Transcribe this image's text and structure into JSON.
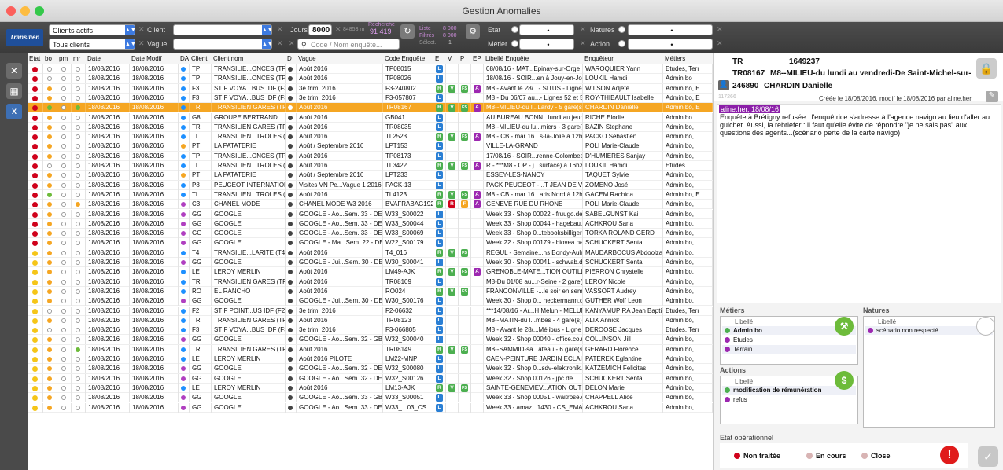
{
  "window": {
    "title": "Gestion Anomalies"
  },
  "toolbar": {
    "logo": "Transilien",
    "client_filter1": "Clients actifs",
    "client_filter2": "Tous clients",
    "client_label": "Client",
    "vague_label": "Vague",
    "jours_label": "Jours",
    "jours_value": "8000",
    "jours_small": "84853 m",
    "recherche_label": "Recherche",
    "recherche_value": "91 419",
    "liste_label": "Liste",
    "liste_value": "8 000",
    "filtres_label": "Filtrés",
    "filtres_value": "8 000",
    "selec_label": "Sélect.",
    "selec_value": "1",
    "search_placeholder": "Code / Nom enquête...",
    "etat_label": "Etat",
    "metier_label": "Métier",
    "natures_label": "Natures",
    "action_label": "Action",
    "dot": "•"
  },
  "columns": [
    "Etat",
    "bo",
    "pm",
    "mr",
    "Date",
    "Date Modif",
    "DA",
    "Client",
    "Client nom",
    "D",
    "Vague",
    "Code Enquête",
    "E",
    "V",
    "P",
    "EP",
    "Libellé Enquête",
    "Enquêteur",
    "Métiers"
  ],
  "rows": [
    {
      "etat": "#d0021b",
      "bo": "o",
      "pm": "o",
      "mr": "o",
      "date": "18/08/2016",
      "modif": "18/08/2016",
      "da": "#1e90ff",
      "cl": "TP",
      "nom": "TRANSILIE...ONCES (TP)",
      "vague": "Août 2016",
      "code": "TP08015",
      "b": [
        "L"
      ],
      "lib": "08/08/16 - MAT...Epinay-sur-Orge",
      "enq": "WAROQUIER Yann",
      "met": "Etudes, Terr"
    },
    {
      "etat": "#d0021b",
      "bo": "o",
      "pm": "o",
      "mr": "o",
      "date": "18/08/2016",
      "modif": "18/08/2016",
      "da": "#1e90ff",
      "cl": "TP",
      "nom": "TRANSILIE...ONCES (TP)",
      "vague": "Août 2016",
      "code": "TP08026",
      "b": [
        "L"
      ],
      "lib": "18/08/16 - SOIR...en à Jouy-en-Josas",
      "enq": "LOUKIL Hamdi",
      "met": "Admin bo"
    },
    {
      "etat": "#d0021b",
      "bo": "y",
      "pm": "o",
      "mr": "o",
      "date": "18/08/2016",
      "modif": "18/08/2016",
      "da": "#1e90ff",
      "cl": "F3",
      "nom": "STIF VOYA...BUS IDF (F3)",
      "vague": "3e trim. 2016",
      "code": "F3-240802",
      "b": [
        "R",
        "V",
        "FS",
        "A"
      ],
      "lib": "M8 - Avant le 28/...- SITUS - Ligne 1",
      "enq": "WILSON Adjété",
      "met": "Admin bo, E"
    },
    {
      "etat": "#d0021b",
      "bo": "y",
      "pm": "o",
      "mr": "o",
      "date": "18/08/2016",
      "modif": "18/08/2016",
      "da": "#1e90ff",
      "cl": "F3",
      "nom": "STIF VOYA...BUS IDF (F3)",
      "vague": "3e trim. 2016",
      "code": "F3-057807",
      "b": [
        "L"
      ],
      "lib": "M8 - Du 06/07 au...- Lignes 52 et 50",
      "enq": "ROY-THIBAULT Isabelle",
      "met": "Admin bo, E"
    },
    {
      "etat": "#d0021b",
      "bo": "g",
      "pm": "o",
      "mr": "g",
      "date": "18/08/2016",
      "modif": "18/08/2016",
      "da": "#1e90ff",
      "cl": "TR",
      "nom": "TRANSILIEN GARES (TR)",
      "vague": "Août 2016",
      "code": "TR08167",
      "b": [
        "R",
        "V",
        "FS",
        "A"
      ],
      "lib": "M8--MILIEU-du l...Lardy - 5 gare(s)",
      "enq": "CHARDIN Danielle",
      "met": "Admin bo, E",
      "sel": true
    },
    {
      "etat": "#d0021b",
      "bo": "y",
      "pm": "o",
      "mr": "o",
      "date": "18/08/2016",
      "modif": "18/08/2016",
      "da": "#1e90ff",
      "cl": "G8",
      "nom": "GROUPE BERTRAND",
      "vague": "Août 2016",
      "code": "GB041",
      "b": [
        "L"
      ],
      "lib": "AU BUREAU BONN...lundi au jeudi soir",
      "enq": "RICHE Elodie",
      "met": "Admin bo"
    },
    {
      "etat": "#d0021b",
      "bo": "y",
      "pm": "o",
      "mr": "o",
      "date": "18/08/2016",
      "modif": "18/08/2016",
      "da": "#1e90ff",
      "cl": "TR",
      "nom": "TRANSILIEN GARES (TR)",
      "vague": "Août 2016",
      "code": "TR08035",
      "b": [
        "L"
      ],
      "lib": "M8--MILIEU-du lu...miers - 3 gare(s)",
      "enq": "BAZIN Stephane",
      "met": "Admin bo,"
    },
    {
      "etat": "#d0021b",
      "bo": "y",
      "pm": "o",
      "mr": "o",
      "date": "18/08/2016",
      "modif": "18/08/2016",
      "da": "#1e90ff",
      "cl": "TL",
      "nom": "TRANSILIEN...TROLES (TL)",
      "vague": "Août 2016",
      "code": "TL2523",
      "b": [
        "R",
        "V",
        "FS",
        "A"
      ],
      "lib": "M8 - CB - mar 16...s-la-Jolie à 12h50",
      "enq": "PACKO Sébastien",
      "met": "Admin bo,"
    },
    {
      "etat": "#d0021b",
      "bo": "y",
      "pm": "o",
      "mr": "o",
      "date": "18/08/2016",
      "modif": "18/08/2016",
      "da": "#f5a623",
      "cl": "PT",
      "nom": "LA PATATERIE",
      "vague": "Août / Septembre 2016",
      "code": "LPT153",
      "b": [
        "L"
      ],
      "lib": "VILLE-LA-GRAND",
      "enq": "POLI Marie-Claude",
      "met": "Admin bo,"
    },
    {
      "etat": "#d0021b",
      "bo": "y",
      "pm": "o",
      "mr": "o",
      "date": "18/08/2016",
      "modif": "18/08/2016",
      "da": "#1e90ff",
      "cl": "TP",
      "nom": "TRANSILIE...ONCES (TP)",
      "vague": "Août 2016",
      "code": "TP08173",
      "b": [
        "L"
      ],
      "lib": "17/08/16 - SOIR...renne-Colombes",
      "enq": "D'HUMIERES Sanjay",
      "met": "Admin bo,"
    },
    {
      "etat": "#d0021b",
      "bo": "o",
      "pm": "o",
      "mr": "o",
      "date": "18/08/2016",
      "modif": "18/08/2016",
      "da": "#1e90ff",
      "cl": "TL",
      "nom": "TRANSILIEN...TROLES (TL)",
      "vague": "Août 2016",
      "code": "TL3422",
      "b": [
        "R",
        "V",
        "FS",
        "A"
      ],
      "lib": "R - ***M8 - OP - j...surface) à 16h30",
      "enq": "LOUKIL Hamdi",
      "met": "Etudes"
    },
    {
      "etat": "#d0021b",
      "bo": "y",
      "pm": "o",
      "mr": "o",
      "date": "18/08/2016",
      "modif": "18/08/2016",
      "da": "#f5a623",
      "cl": "PT",
      "nom": "LA PATATERIE",
      "vague": "Août / Septembre 2016",
      "code": "LPT233",
      "b": [
        "L"
      ],
      "lib": "ESSEY-LES-NANCY",
      "enq": "TAQUET Sylvie",
      "met": "Admin bo,"
    },
    {
      "etat": "#d0021b",
      "bo": "y",
      "pm": "o",
      "mr": "o",
      "date": "18/08/2016",
      "modif": "18/08/2016",
      "da": "#1e90ff",
      "cl": "P8",
      "nom": "PEUGEOT INTERNATIONAL",
      "vague": "Visites VN Pe...Vague 1 2016",
      "code": "PACK-13",
      "b": [
        "L"
      ],
      "lib": "PACK PEUGEOT -...T JEAN DE VEDAS",
      "enq": "ZOMENO José",
      "met": "Admin bo,"
    },
    {
      "etat": "#d0021b",
      "bo": "g",
      "pm": "o",
      "mr": "o",
      "date": "18/08/2016",
      "modif": "18/08/2016",
      "da": "#1e90ff",
      "cl": "TL",
      "nom": "TRANSILIEN...TROLES (TL)",
      "vague": "Août 2016",
      "code": "TL4123",
      "b": [
        "R",
        "V",
        "FS",
        "A"
      ],
      "lib": "M8 - CB - mar 16...aris Nord à 12h10",
      "enq": "GACEM Rachida",
      "met": "Admin bo, E"
    },
    {
      "etat": "#d0021b",
      "bo": "y",
      "pm": "o",
      "mr": "y",
      "date": "18/08/2016",
      "modif": "18/08/2016",
      "da": "#b03fc0",
      "cl": "C3",
      "nom": "CHANEL MODE",
      "vague": "CHANEL MODE W3 2016",
      "code": "BVAFRABAG192",
      "b": [
        "R",
        "Rr",
        "F",
        "A"
      ],
      "lib": "GENEVE RUE DU RHONE",
      "enq": "POLI Marie-Claude",
      "met": "Admin bo,"
    },
    {
      "etat": "#d0021b",
      "bo": "y",
      "pm": "o",
      "mr": "o",
      "date": "18/08/2016",
      "modif": "18/08/2016",
      "da": "#b03fc0",
      "cl": "GG",
      "nom": "GOOGLE",
      "vague": "GOOGLE - Ao...Sem. 33 - DE",
      "code": "W33_S00022",
      "b": [
        "L"
      ],
      "lib": "Week 33 - Shop 00022 - fruugo.de",
      "enq": "SABELGUNST Kai",
      "met": "Admin bo,"
    },
    {
      "etat": "#d0021b",
      "bo": "y",
      "pm": "o",
      "mr": "o",
      "date": "18/08/2016",
      "modif": "18/08/2016",
      "da": "#b03fc0",
      "cl": "GG",
      "nom": "GOOGLE",
      "vague": "GOOGLE - Ao...Sem. 33 - DE",
      "code": "W33_S00044",
      "b": [
        "L"
      ],
      "lib": "Week 33 - Shop 00044 - hagebau.de",
      "enq": "ACHKROU Sana",
      "met": "Admin bo,"
    },
    {
      "etat": "#d0021b",
      "bo": "y",
      "pm": "o",
      "mr": "o",
      "date": "18/08/2016",
      "modif": "18/08/2016",
      "da": "#b03fc0",
      "cl": "GG",
      "nom": "GOOGLE",
      "vague": "GOOGLE - Ao...Sem. 33 - DE",
      "code": "W33_S00069",
      "b": [
        "L"
      ],
      "lib": "Week 33 - Shop 0...tebooksbilliger.de",
      "enq": "TORKA ROLAND GERD",
      "met": "Admin bo,"
    },
    {
      "etat": "#d0021b",
      "bo": "y",
      "pm": "o",
      "mr": "o",
      "date": "18/08/2016",
      "modif": "18/08/2016",
      "da": "#b03fc0",
      "cl": "GG",
      "nom": "GOOGLE",
      "vague": "GOOGLE - Ma...Sem. 22 - DE",
      "code": "W22_S00179",
      "b": [
        "L"
      ],
      "lib": "Week 22 - Shop 00179 - biovea.net",
      "enq": "SCHUCKERT Senta",
      "met": "Admin bo,"
    },
    {
      "etat": "#f5c518",
      "bo": "y",
      "pm": "o",
      "mr": "o",
      "date": "18/08/2016",
      "modif": "18/08/2016",
      "da": "#1e90ff",
      "cl": "T4",
      "nom": "TRANSILIE...LARITE (T4)",
      "vague": "Août 2016",
      "code": "T4_016",
      "b": [
        "R",
        "V",
        "FS"
      ],
      "lib": "REGUL - Semaine...ns Bondy-Aulnay",
      "enq": "MAUDARBOCUS Abdoolzahid",
      "met": "Admin bo,"
    },
    {
      "etat": "#f5c518",
      "bo": "y",
      "pm": "o",
      "mr": "o",
      "date": "18/08/2016",
      "modif": "18/08/2016",
      "da": "#b03fc0",
      "cl": "GG",
      "nom": "GOOGLE",
      "vague": "GOOGLE - Jui...Sem. 30 - DE",
      "code": "W30_S00041",
      "b": [
        "L"
      ],
      "lib": "Week 30 - Shop 00041 - schwab.de",
      "enq": "SCHUCKERT Senta",
      "met": "Admin bo,"
    },
    {
      "etat": "#f5c518",
      "bo": "y",
      "pm": "o",
      "mr": "o",
      "date": "18/08/2016",
      "modif": "18/08/2016",
      "da": "#1e90ff",
      "cl": "LE",
      "nom": "LEROY MERLIN",
      "vague": "Août 2016",
      "code": "LM49-AJK",
      "b": [
        "R",
        "V",
        "FS",
        "A"
      ],
      "lib": "GRENOBLE-MATE...TION OUTILLAGE",
      "enq": "PIERRON Chrystelle",
      "met": "Admin bo,"
    },
    {
      "etat": "#f5c518",
      "bo": "y",
      "pm": "o",
      "mr": "o",
      "date": "18/08/2016",
      "modif": "18/08/2016",
      "da": "#1e90ff",
      "cl": "TR",
      "nom": "TRANSILIEN GARES (TR)",
      "vague": "Août 2016",
      "code": "TR08109",
      "b": [
        "L"
      ],
      "lib": "M8-Du 01/08 au...r-Seine - 2 gare(s)",
      "enq": "LEROY Nicole",
      "met": "Admin bo,"
    },
    {
      "etat": "#f5c518",
      "bo": "y",
      "pm": "o",
      "mr": "o",
      "date": "18/08/2016",
      "modif": "18/08/2016",
      "da": "#1e90ff",
      "cl": "RO",
      "nom": "EL RANCHO",
      "vague": "Août 2016",
      "code": "RO024",
      "b": [
        "R",
        "V",
        "FS"
      ],
      "lib": "FRANCONVILLE -...le soir en semaine",
      "enq": "VASSORT Audrey",
      "met": "Admin bo,"
    },
    {
      "etat": "#f5c518",
      "bo": "y",
      "pm": "o",
      "mr": "o",
      "date": "18/08/2016",
      "modif": "18/08/2016",
      "da": "#b03fc0",
      "cl": "GG",
      "nom": "GOOGLE",
      "vague": "GOOGLE - Jui...Sem. 30 - DE",
      "code": "W30_S00176",
      "b": [
        "L"
      ],
      "lib": "Week 30 - Shop 0... neckermann.de",
      "enq": "GUTHER Wolf Leon",
      "met": "Admin bo,"
    },
    {
      "etat": "#f5c518",
      "bo": "o",
      "pm": "o",
      "mr": "o",
      "date": "18/08/2016",
      "modif": "18/08/2016",
      "da": "#1e90ff",
      "cl": "F2",
      "nom": "STIF POINT...US IDF (F2)",
      "vague": "3e trim. 2016",
      "code": "F2-06632",
      "b": [
        "L"
      ],
      "lib": "***14/08/16 - Ar...H Melun - MELUN",
      "enq": "KANYAMUPIRA Jean Baptiste",
      "met": "Etudes, Terr"
    },
    {
      "etat": "#f5c518",
      "bo": "y",
      "pm": "o",
      "mr": "o",
      "date": "18/08/2016",
      "modif": "18/08/2016",
      "da": "#1e90ff",
      "cl": "TR",
      "nom": "TRANSILIEN GARES (TR)",
      "vague": "Août 2016",
      "code": "TR08123",
      "b": [
        "L"
      ],
      "lib": "M8--MATIN-du l...mbes - 4 gare(s)",
      "enq": "ALIX Annick",
      "met": "Admin bo,"
    },
    {
      "etat": "#f5c518",
      "bo": "o",
      "pm": "o",
      "mr": "o",
      "date": "18/08/2016",
      "modif": "18/08/2016",
      "da": "#1e90ff",
      "cl": "F3",
      "nom": "STIF VOYA...BUS IDF (F3)",
      "vague": "3e trim. 2016",
      "code": "F3-066805",
      "b": [
        "L"
      ],
      "lib": "M8 - Avant le 28/...Mélibus - Ligne A",
      "enq": "DEROOSE Jacques",
      "met": "Etudes, Terr"
    },
    {
      "etat": "#f5c518",
      "bo": "y",
      "pm": "o",
      "mr": "o",
      "date": "18/08/2016",
      "modif": "18/08/2016",
      "da": "#b03fc0",
      "cl": "GG",
      "nom": "GOOGLE",
      "vague": "GOOGLE - Ao...Sem. 32 - GB",
      "code": "W32_S00040",
      "b": [
        "L"
      ],
      "lib": "Week 32 - Shop 00040 - office.co.uk",
      "enq": "COLLINSON Jill",
      "met": "Admin bo,"
    },
    {
      "etat": "#f5c518",
      "bo": "y",
      "pm": "o",
      "mr": "g",
      "date": "18/08/2016",
      "modif": "18/08/2016",
      "da": "#1e90ff",
      "cl": "TR",
      "nom": "TRANSILIEN GARES (TR)",
      "vague": "Août 2016",
      "code": "TR08149",
      "b": [
        "R",
        "V",
        "FS"
      ],
      "lib": "M8--SAMMID-sa...âteau - 6 gare(s)",
      "enq": "GERARD Florence",
      "met": "Admin bo,"
    },
    {
      "etat": "#f5c518",
      "bo": "y",
      "pm": "o",
      "mr": "o",
      "date": "18/08/2016",
      "modif": "18/08/2016",
      "da": "#1e90ff",
      "cl": "LE",
      "nom": "LEROY MERLIN",
      "vague": "Août 2016 PILOTE",
      "code": "LM22-MNP",
      "b": [
        "L"
      ],
      "lib": "CAEN-PEINTURE JARDIN ECLAIRAGE",
      "enq": "PATEREK Eglantine",
      "met": "Admin bo,"
    },
    {
      "etat": "#f5c518",
      "bo": "y",
      "pm": "o",
      "mr": "o",
      "date": "18/08/2016",
      "modif": "18/08/2016",
      "da": "#b03fc0",
      "cl": "GG",
      "nom": "GOOGLE",
      "vague": "GOOGLE - Ao...Sem. 32 - DE",
      "code": "W32_S00080",
      "b": [
        "L"
      ],
      "lib": "Week 32 - Shop 0...sdv-elektronik.de",
      "enq": "KATZEMICH Felicitas",
      "met": "Admin bo,"
    },
    {
      "etat": "#f5c518",
      "bo": "y",
      "pm": "o",
      "mr": "o",
      "date": "18/08/2016",
      "modif": "18/08/2016",
      "da": "#b03fc0",
      "cl": "GG",
      "nom": "GOOGLE",
      "vague": "GOOGLE - Ao...Sem. 32 - DE",
      "code": "W32_S00126",
      "b": [
        "L"
      ],
      "lib": "Week 32 - Shop 00126 - jpc.de",
      "enq": "SCHUCKERT Senta",
      "met": "Admin bo,"
    },
    {
      "etat": "#f5c518",
      "bo": "y",
      "pm": "o",
      "mr": "o",
      "date": "18/08/2016",
      "modif": "18/08/2016",
      "da": "#1e90ff",
      "cl": "LE",
      "nom": "LEROY MERLIN",
      "vague": "Août 2016",
      "code": "LM13-AJK",
      "b": [
        "R",
        "V",
        "FS"
      ],
      "lib": "SAINTE-GENEVIEV...ATION OUTILLAGE",
      "enq": "DELON Marie",
      "met": "Admin bo,"
    },
    {
      "etat": "#f5c518",
      "bo": "y",
      "pm": "o",
      "mr": "o",
      "date": "18/08/2016",
      "modif": "18/08/2016",
      "da": "#b03fc0",
      "cl": "GG",
      "nom": "GOOGLE",
      "vague": "GOOGLE - Ao...Sem. 33 - GB",
      "code": "W33_S00051",
      "b": [
        "L"
      ],
      "lib": "Week 33 - Shop 00051 - waitrose.com",
      "enq": "CHAPPELL Alice",
      "met": "Admin bo,"
    },
    {
      "etat": "#f5c518",
      "bo": "y",
      "pm": "o",
      "mr": "o",
      "date": "18/08/2016",
      "modif": "18/08/2016",
      "da": "#b03fc0",
      "cl": "GG",
      "nom": "GOOGLE",
      "vague": "GOOGLE - Ao...Sem. 33 - DE",
      "code": "W33_...03_CS",
      "b": [
        "L"
      ],
      "lib": "Week 33 - amaz...1430 - CS_EMAIL",
      "enq": "ACHKROU Sana",
      "met": "Admin bo,"
    }
  ],
  "detail": {
    "code_prefix": "TR",
    "code_num": "1649237",
    "enq_code": "TR08167",
    "enq_title": "M8--MILIEU-du lundi au vendredi-De Saint-Michel-sur-",
    "person_id": "246890",
    "person_name": "CHARDIN Danielle",
    "ref": "117266",
    "created": "Créée le 18/08/2016, modif le 18/08/2016 par aline.her",
    "comment_head": "aline.her, 18/08/16",
    "comment_body": "Enquête à Brétigny refusée : l'enquêtrice s'adresse à l'agence navigo au lieu d'aller au guichet. Aussi, la rebriefer : il faut qu'elle évite de répondre \"je ne sais pas\" aux questions des agents...(scénario perte de la carte navigo)"
  },
  "metiers": {
    "title": "Métiers",
    "col": "Libellé",
    "items": [
      {
        "label": "Admin bo",
        "color": "#4caf50",
        "bold": true
      },
      {
        "label": "Etudes",
        "color": "#9c27b0"
      },
      {
        "label": "Terrain",
        "color": "#9c27b0"
      }
    ]
  },
  "natures": {
    "title": "Natures",
    "col": "Libellé",
    "items": [
      {
        "label": "scénario non respecté",
        "color": "#9c27b0"
      }
    ]
  },
  "actions": {
    "title": "Actions",
    "col": "Libellé",
    "items": [
      {
        "label": "modification de rémunération",
        "color": "#4caf50",
        "bold": true
      },
      {
        "label": "refus",
        "color": "#9c27b0"
      }
    ]
  },
  "etat_op": {
    "title": "Etat opérationnel",
    "opts": [
      {
        "label": "Non traitée",
        "color": "#d0021b"
      },
      {
        "label": "En cours",
        "color": "#d8b4b4"
      },
      {
        "label": "Close",
        "color": "#d8b4b4"
      }
    ]
  },
  "icons": {
    "refresh": "refresh-icon",
    "gear": "gear-icon",
    "search": "search-icon",
    "lock": "lock-icon",
    "user": "user-icon",
    "pencil": "pencil-icon",
    "check": "check-icon",
    "alert": "alert-icon",
    "close": "close-icon",
    "grid": "grid-icon",
    "excel": "excel-icon",
    "dollar": "dollar-icon",
    "worker": "worker-icon"
  }
}
